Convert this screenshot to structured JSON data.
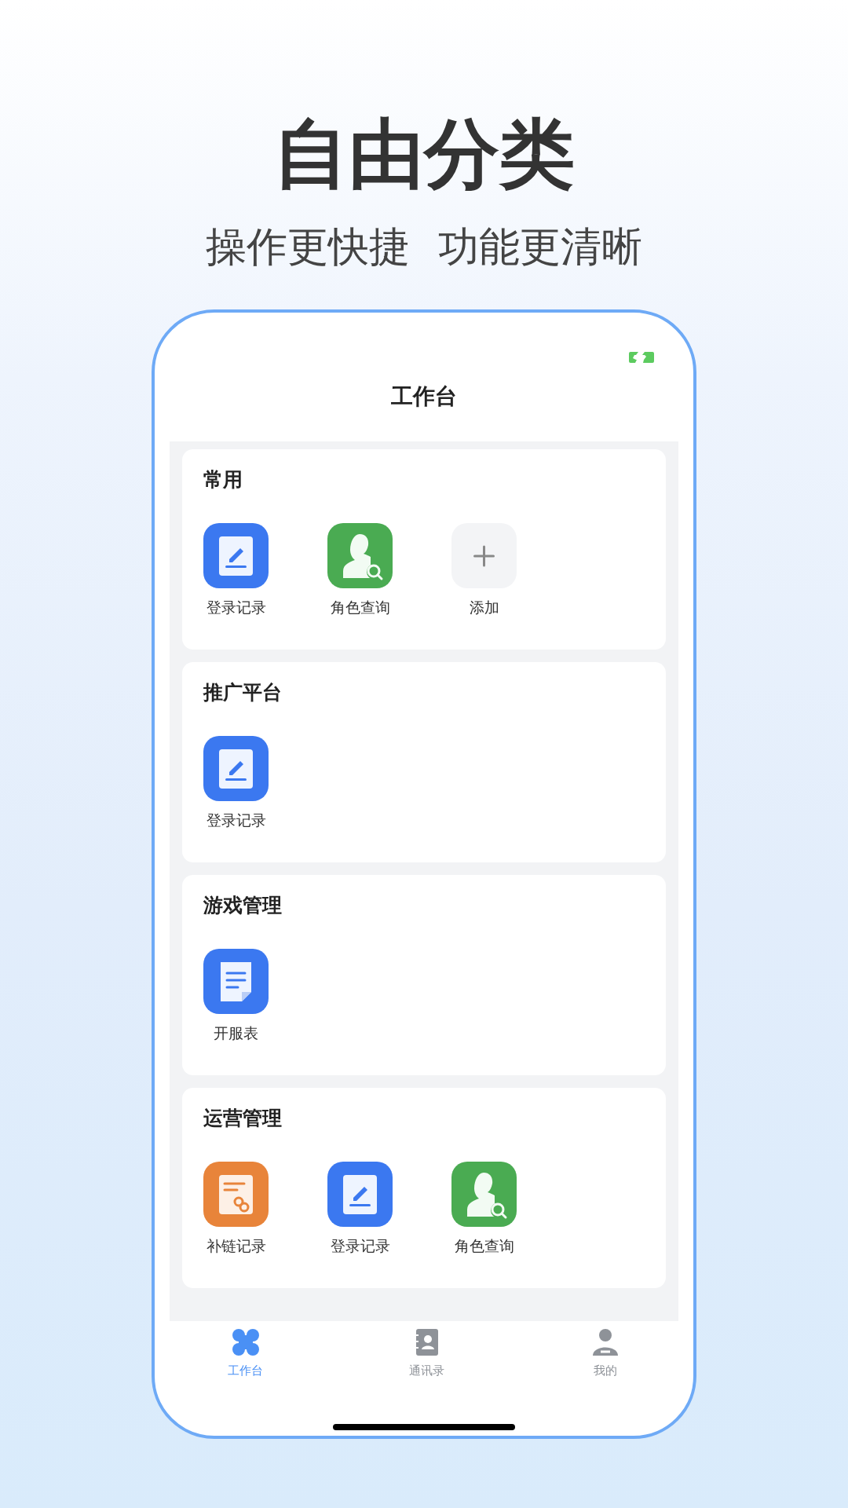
{
  "headline": "自由分类",
  "subtitles": [
    "操作更快捷",
    "功能更清晰"
  ],
  "screen": {
    "title": "工作台"
  },
  "sections": [
    {
      "title": "常用",
      "apps": [
        {
          "kind": "login",
          "label": "登录记录"
        },
        {
          "kind": "role",
          "label": "角色查询"
        },
        {
          "kind": "add",
          "label": "添加"
        }
      ]
    },
    {
      "title": "推广平台",
      "apps": [
        {
          "kind": "login",
          "label": "登录记录"
        }
      ]
    },
    {
      "title": "游戏管理",
      "apps": [
        {
          "kind": "server",
          "label": "开服表"
        }
      ]
    },
    {
      "title": "运营管理",
      "apps": [
        {
          "kind": "link",
          "label": "补链记录"
        },
        {
          "kind": "login",
          "label": "登录记录"
        },
        {
          "kind": "role",
          "label": "角色查询"
        }
      ]
    }
  ],
  "tabs": [
    {
      "kind": "workbench",
      "label": "工作台",
      "selected": true
    },
    {
      "kind": "contacts",
      "label": "通讯录",
      "selected": false
    },
    {
      "kind": "me",
      "label": "我的",
      "selected": false
    }
  ]
}
